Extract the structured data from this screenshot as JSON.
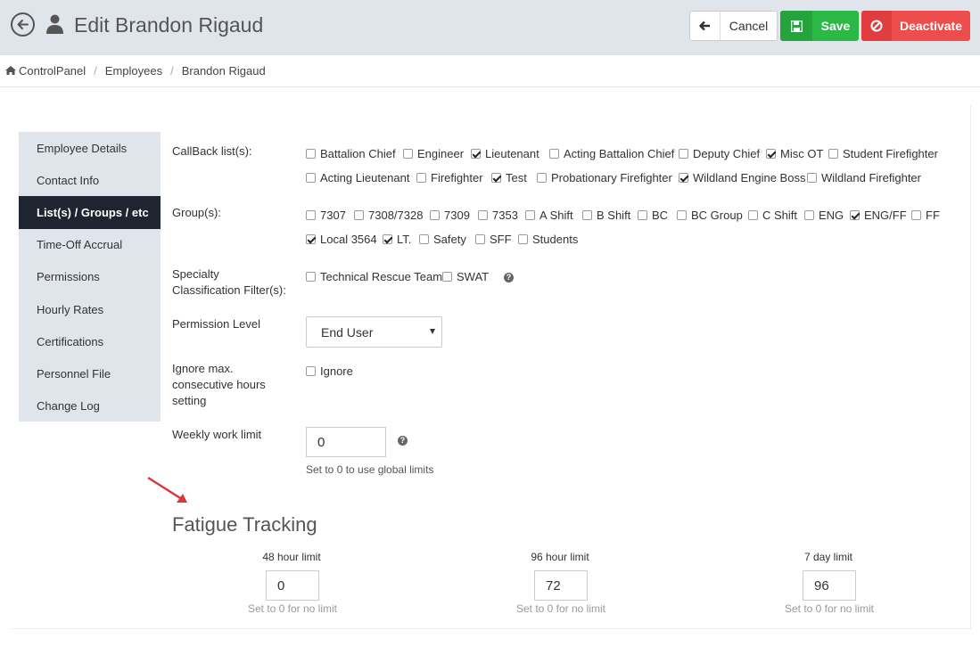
{
  "header": {
    "title": "Edit Brandon Rigaud",
    "cancel_label": "Cancel",
    "save_label": "Save",
    "deactivate_label": "Deactivate"
  },
  "breadcrumb": [
    "ControlPanel",
    "Employees",
    "Brandon Rigaud"
  ],
  "sidebar": {
    "items": [
      {
        "label": "Employee Details",
        "active": false
      },
      {
        "label": "Contact Info",
        "active": false
      },
      {
        "label": "List(s) / Groups / etc",
        "active": true
      },
      {
        "label": "Time-Off Accrual",
        "active": false
      },
      {
        "label": "Permissions",
        "active": false
      },
      {
        "label": "Hourly Rates",
        "active": false
      },
      {
        "label": "Certifications",
        "active": false
      },
      {
        "label": "Personnel File",
        "active": false
      },
      {
        "label": "Change Log",
        "active": false
      }
    ]
  },
  "form": {
    "callback_label": "CallBack list(s):",
    "callback": [
      {
        "label": "Battalion Chief",
        "checked": false
      },
      {
        "label": "Engineer",
        "checked": false
      },
      {
        "label": "Lieutenant",
        "checked": true
      },
      {
        "label": "Acting Battalion Chief",
        "checked": false
      },
      {
        "label": "Deputy Chief",
        "checked": false
      },
      {
        "label": "Misc OT",
        "checked": true
      },
      {
        "label": "Student Firefighter",
        "checked": false
      },
      {
        "label": "Acting Lieutenant",
        "checked": false
      },
      {
        "label": "Firefighter",
        "checked": false
      },
      {
        "label": "Test",
        "checked": true
      },
      {
        "label": "Probationary Firefighter",
        "checked": false
      },
      {
        "label": "Wildland Engine Boss",
        "checked": true
      },
      {
        "label": "Wildland Firefighter",
        "checked": false
      }
    ],
    "groups_label": "Group(s):",
    "groups": [
      {
        "label": "7307",
        "checked": false
      },
      {
        "label": "7308/7328",
        "checked": false
      },
      {
        "label": "7309",
        "checked": false
      },
      {
        "label": "7353",
        "checked": false
      },
      {
        "label": "A Shift",
        "checked": false
      },
      {
        "label": "B Shift",
        "checked": false
      },
      {
        "label": "BC",
        "checked": false
      },
      {
        "label": "BC Group",
        "checked": false
      },
      {
        "label": "C Shift",
        "checked": false
      },
      {
        "label": "ENG",
        "checked": false
      },
      {
        "label": "ENG/FF",
        "checked": true
      },
      {
        "label": "FF",
        "checked": false
      },
      {
        "label": "Local 3564",
        "checked": true
      },
      {
        "label": "LT.",
        "checked": true
      },
      {
        "label": "Safety",
        "checked": false
      },
      {
        "label": "SFF",
        "checked": false
      },
      {
        "label": "Students",
        "checked": false
      }
    ],
    "specialty_label_1": "Specialty",
    "specialty_label_2": "Classification Filter(s):",
    "specialty": [
      {
        "label": "Technical Rescue Team",
        "checked": false
      },
      {
        "label": "SWAT",
        "checked": false
      }
    ],
    "permission_label": "Permission Level",
    "permission_value": "End User",
    "ignore_label_1": "Ignore max.",
    "ignore_label_2": "consecutive hours",
    "ignore_label_3": "setting",
    "ignore_option": {
      "label": "Ignore",
      "checked": false
    },
    "weekly_label": "Weekly work limit",
    "weekly_value": "0",
    "weekly_hint": "Set to 0 to use global limits"
  },
  "fatigue": {
    "title": "Fatigue Tracking",
    "limits": [
      {
        "label": "48 hour limit",
        "value": "0",
        "hint": "Set to 0 for no limit"
      },
      {
        "label": "96 hour limit",
        "value": "72",
        "hint": "Set to 0 for no limit"
      },
      {
        "label": "7 day limit",
        "value": "96",
        "hint": "Set to 0 for no limit"
      }
    ]
  },
  "colors": {
    "header_bg": "#dfe5ea",
    "save": "#2bb845",
    "deactivate": "#ee4d4d",
    "nav_active": "#1e2530",
    "annotation_arrow": "#d9383a"
  }
}
